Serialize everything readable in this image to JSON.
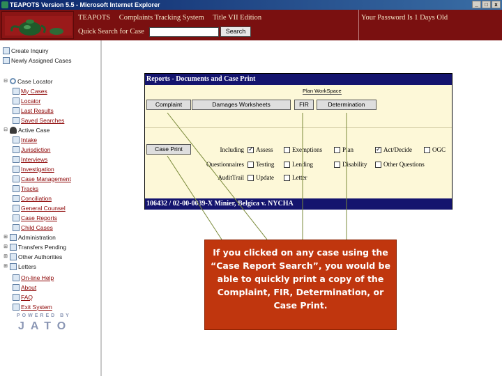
{
  "window": {
    "title": "TEAPOTS Version 5.5 - Microsoft Internet Explorer",
    "controls": [
      "_",
      "□",
      "x"
    ]
  },
  "header": {
    "title_parts": [
      "TEAPOTS",
      "Complaints Tracking System",
      "Title VII Edition"
    ],
    "search_label": "Quick Search for Case",
    "search_value": "",
    "search_button": "Search",
    "password_notice": "Your Password Is 1 Days Old"
  },
  "sidebar": {
    "items": [
      {
        "label": "Create Inquiry",
        "expander": "",
        "icon": "document-icon",
        "link": false
      },
      {
        "label": "Newly Assigned Cases",
        "expander": "",
        "icon": "document-icon",
        "link": false
      },
      {
        "label": "Case Locator",
        "expander": "⊟",
        "icon": "magnifier-icon",
        "link": false
      },
      {
        "label": "My Cases",
        "expander": "",
        "icon": "document-icon",
        "link": true
      },
      {
        "label": "Locator",
        "expander": "",
        "icon": "document-icon",
        "link": true
      },
      {
        "label": "Last Results",
        "expander": "",
        "icon": "document-icon",
        "link": true
      },
      {
        "label": "Saved Searches",
        "expander": "",
        "icon": "document-icon",
        "link": true
      },
      {
        "label": "Active Case",
        "expander": "⊟",
        "icon": "person-icon",
        "link": false
      },
      {
        "label": "Intake",
        "expander": "",
        "icon": "document-icon",
        "link": true
      },
      {
        "label": "Jurisdiction",
        "expander": "",
        "icon": "document-icon",
        "link": true
      },
      {
        "label": "Interviews",
        "expander": "",
        "icon": "document-icon",
        "link": true
      },
      {
        "label": "Investigation",
        "expander": "",
        "icon": "document-icon",
        "link": true
      },
      {
        "label": "Case Management",
        "expander": "",
        "icon": "document-icon",
        "link": true
      },
      {
        "label": "Tracks",
        "expander": "",
        "icon": "document-icon",
        "link": true
      },
      {
        "label": "Conciliation",
        "expander": "",
        "icon": "document-icon",
        "link": true
      },
      {
        "label": "General Counsel",
        "expander": "",
        "icon": "document-icon",
        "link": true
      },
      {
        "label": "Case Reports",
        "expander": "",
        "icon": "document-icon",
        "link": true
      },
      {
        "label": "Child Cases",
        "expander": "",
        "icon": "document-icon",
        "link": true
      },
      {
        "label": "Administration",
        "expander": "⊞",
        "icon": "document-icon",
        "link": false
      },
      {
        "label": "Transfers Pending",
        "expander": "⊞",
        "icon": "document-icon",
        "link": false
      },
      {
        "label": "Other Authorities",
        "expander": "⊞",
        "icon": "document-icon",
        "link": false
      },
      {
        "label": "Letters",
        "expander": "⊞",
        "icon": "document-icon",
        "link": false
      },
      {
        "label": "On-line Help",
        "expander": "",
        "icon": "document-icon",
        "link": true
      },
      {
        "label": "About",
        "expander": "",
        "icon": "document-icon",
        "link": true
      },
      {
        "label": "FAQ",
        "expander": "",
        "icon": "document-icon",
        "link": true
      },
      {
        "label": "Exit System",
        "expander": "",
        "icon": "document-icon",
        "link": true
      }
    ],
    "powered_by": "POWERED BY",
    "brand": "JATO"
  },
  "reports": {
    "title": "Reports - Documents and Case Print",
    "tab_label": "Plan WorkSpace",
    "doc_buttons": [
      "Complaint",
      "Damages Worksheets",
      "FIR",
      "Determination"
    ],
    "case_print_button": "Case Print",
    "rows": [
      {
        "label": "Including",
        "options": [
          {
            "label": "Assess",
            "checked": true
          },
          {
            "label": "Exemptions",
            "checked": false
          },
          {
            "label": "Plan",
            "checked": false
          },
          {
            "label": "Act/Decide",
            "checked": true
          },
          {
            "label": "OGC",
            "checked": false
          }
        ]
      },
      {
        "label": "Questionnaires",
        "options": [
          {
            "label": "Testing",
            "checked": false
          },
          {
            "label": "Lending",
            "checked": false
          },
          {
            "label": "Disability",
            "checked": false
          },
          {
            "label": "Other Questions",
            "checked": false
          }
        ]
      },
      {
        "label": "AuditTrail",
        "options": [
          {
            "label": "Update",
            "checked": false
          },
          {
            "label": "Letter",
            "checked": false
          }
        ]
      }
    ],
    "case_line": "106432 / 02-00-0039-X Minier, Belgica v. NYCHA"
  },
  "callout": {
    "text": "If you clicked on any case using the “Case Report Search”, you would be able to quickly print a copy of the Complaint, FIR, Determination, or Case Print."
  },
  "colors": {
    "header_bg": "#7a1010",
    "panel_head": "#14146e",
    "panel_bg": "#fdf8d8",
    "callout_bg": "#c0360e",
    "link": "#8b0000"
  }
}
